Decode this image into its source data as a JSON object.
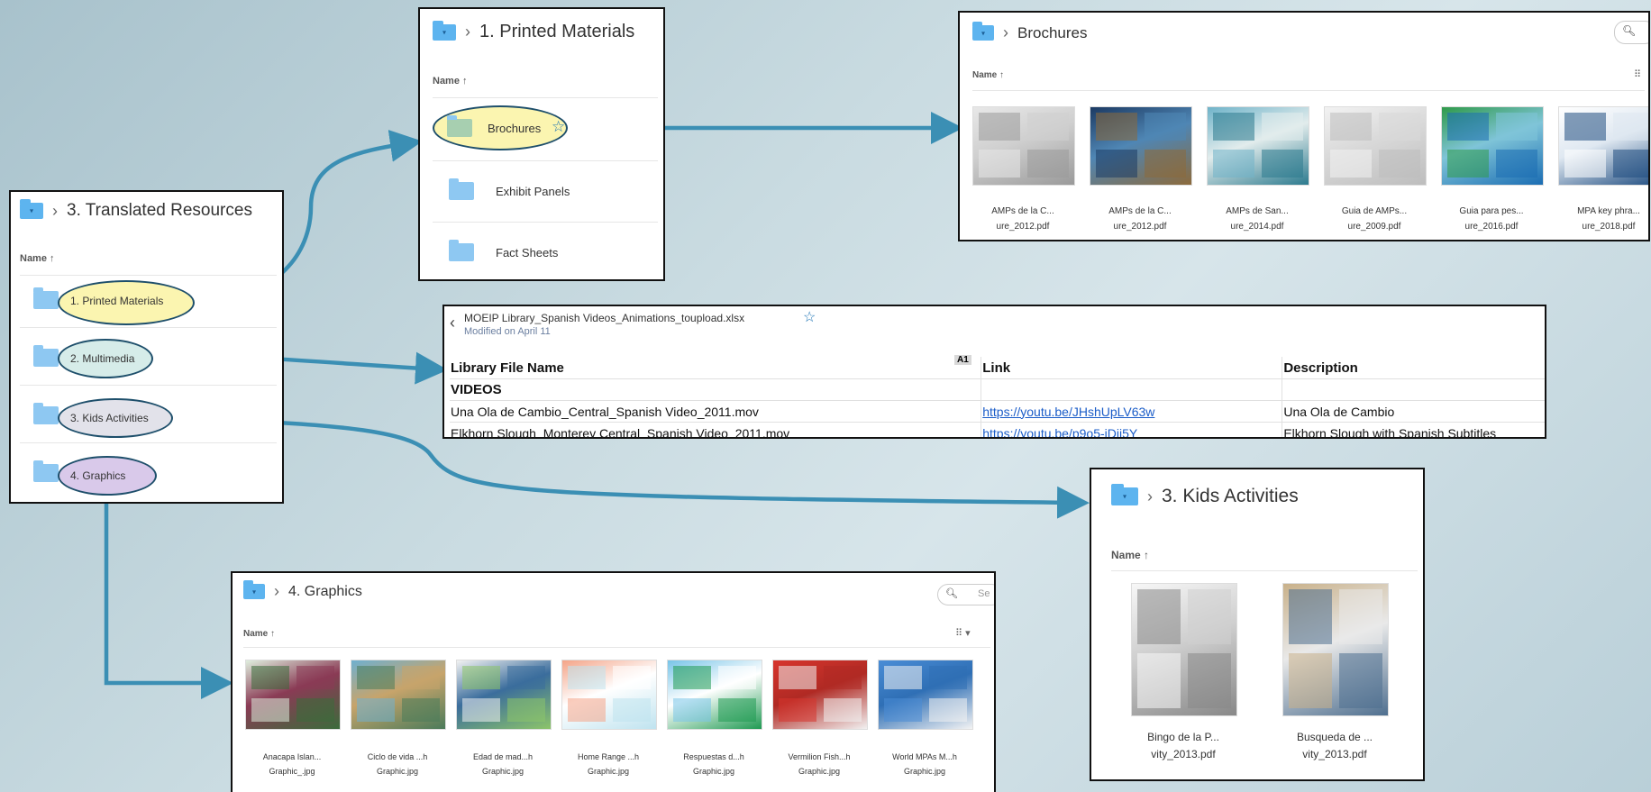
{
  "colors": {
    "arrow": "#3b8fb4",
    "oval_border": "#1e4f6b",
    "folder": "#8ec8f2"
  },
  "translated": {
    "title": "3. Translated Resources",
    "name_header": "Name ↑",
    "items": [
      {
        "label": "1. Printed Materials",
        "highlight": "#fbf5b0"
      },
      {
        "label": "2. Multimedia",
        "highlight": "#d6ece9"
      },
      {
        "label": "3. Kids Activities",
        "highlight": "#e2e2ea"
      },
      {
        "label": "4. Graphics",
        "highlight": "#d9c9ea"
      }
    ]
  },
  "printed": {
    "title": "1. Printed Materials",
    "name_header": "Name ↑",
    "items": [
      {
        "label": "Brochures",
        "star": "☆"
      },
      {
        "label": "Exhibit Panels"
      },
      {
        "label": "Fact Sheets"
      }
    ]
  },
  "brochures": {
    "title": "Brochures",
    "name_header": "Name ↑",
    "search_icon": "magnifier-icon",
    "files": [
      {
        "line1": "AMPs de la C...",
        "line2": "ure_2012.pdf",
        "palette": [
          "#e8e8e8",
          "#9a9a9a",
          "#cfcfcf"
        ]
      },
      {
        "line1": "AMPs de la C...",
        "line2": "ure_2012.pdf",
        "palette": [
          "#1c3a63",
          "#8c6a3b",
          "#4f86b4"
        ]
      },
      {
        "line1": "AMPs de San...",
        "line2": "ure_2014.pdf",
        "palette": [
          "#6fb3c9",
          "#2c7a8e",
          "#e2ecec"
        ]
      },
      {
        "line1": "Guia de AMPs...",
        "line2": "ure_2009.pdf",
        "palette": [
          "#f2f2f2",
          "#bdbdbd",
          "#d9d9d9"
        ]
      },
      {
        "line1": "Guia para pes...",
        "line2": "ure_2016.pdf",
        "palette": [
          "#2f9a4a",
          "#1b6db3",
          "#7fc4d8"
        ]
      },
      {
        "line1": "MPA key phra...",
        "line2": "ure_2018.pdf",
        "palette": [
          "#ffffff",
          "#1f4c80",
          "#dfe8f1"
        ]
      }
    ]
  },
  "sheet": {
    "filename": "MOEIP Library_Spanish Videos_Animations_toupload.xlsx",
    "star": "☆",
    "modified": "Modified on April 11",
    "cell_ref": "A1",
    "headers": [
      "Library File Name",
      "Link",
      "Description"
    ],
    "section": "VIDEOS",
    "rows": [
      [
        "Una Ola de Cambio_Central_Spanish Video_2011.mov",
        "https://youtu.be/JHshUpLV63w",
        "Una Ola de Cambio"
      ],
      [
        "Elkhorn Slough_Monterey Central_Spanish Video_2011.mov",
        "https://youtu.be/p9o5-iDji5Y",
        "Elkhorn Slough with Spanish Subtitles"
      ]
    ]
  },
  "kids": {
    "title": "3. Kids Activities",
    "name_header": "Name ↑",
    "files": [
      {
        "line1": "Bingo de la P...",
        "line2": "vity_2013.pdf",
        "palette": [
          "#f7f7f7",
          "#888888",
          "#cfcfcf"
        ]
      },
      {
        "line1": "Busqueda de ...",
        "line2": "vity_2013.pdf",
        "palette": [
          "#c9b18a",
          "#4f6f8f",
          "#e9e9e9"
        ]
      }
    ]
  },
  "graphics": {
    "title": "4. Graphics",
    "name_header": "Name ↑",
    "search_placeholder": "Se",
    "files": [
      {
        "line1": "Anacapa Islan...",
        "line2": "Graphic_.jpg",
        "palette": [
          "#dfeede",
          "#3b6b3b",
          "#8a3b55"
        ]
      },
      {
        "line1": "Ciclo de vida ...h",
        "line2": "Graphic.jpg",
        "palette": [
          "#6fb0cf",
          "#4b7b5a",
          "#c7a46b"
        ]
      },
      {
        "line1": "Edad de mad...h",
        "line2": "Graphic.jpg",
        "palette": [
          "#f2f2f2",
          "#8cc46a",
          "#3b6d9c"
        ]
      },
      {
        "line1": "Home Range ...h",
        "line2": "Graphic.jpg",
        "palette": [
          "#f4a488",
          "#bfe3ef",
          "#ffffff"
        ]
      },
      {
        "line1": "Respuestas d...h",
        "line2": "Graphic.jpg",
        "palette": [
          "#78c4e8",
          "#1f9a52",
          "#ffffff"
        ]
      },
      {
        "line1": "Vermilion Fish...h",
        "line2": "Graphic.jpg",
        "palette": [
          "#d7352d",
          "#f1f1f1",
          "#b02a24"
        ]
      },
      {
        "line1": "World MPAs M...h",
        "line2": "Graphic.jpg",
        "palette": [
          "#4a8dd6",
          "#f3f3f3",
          "#2f6fb5"
        ]
      }
    ]
  }
}
